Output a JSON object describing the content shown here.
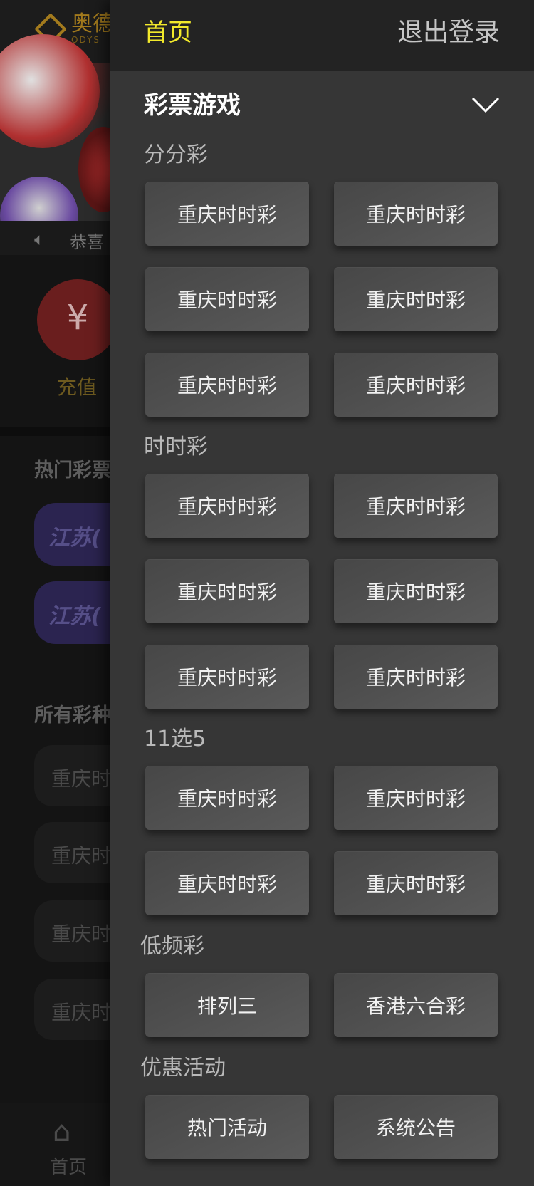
{
  "background": {
    "logo_text": "奥德",
    "logo_sub": "ODYS",
    "notice_text": "恭喜",
    "recharge_label": "充值",
    "hot_title": "热门彩票",
    "hot_items": [
      "江苏(",
      "江苏("
    ],
    "all_title": "所有彩种",
    "all_items": [
      "重庆时",
      "重庆时",
      "重庆时",
      "重庆时"
    ],
    "tab_home": "首页"
  },
  "drawer": {
    "home_label": "首页",
    "logout_label": "退出登录",
    "category_title": "彩票游戏",
    "groups": [
      {
        "label": "分分彩",
        "items": [
          "重庆时时彩",
          "重庆时时彩",
          "重庆时时彩",
          "重庆时时彩",
          "重庆时时彩",
          "重庆时时彩"
        ]
      },
      {
        "label": "时时彩",
        "items": [
          "重庆时时彩",
          "重庆时时彩",
          "重庆时时彩",
          "重庆时时彩",
          "重庆时时彩",
          "重庆时时彩"
        ]
      },
      {
        "label": "11选5",
        "items": [
          "重庆时时彩",
          "重庆时时彩",
          "重庆时时彩",
          "重庆时时彩"
        ]
      },
      {
        "label": "低频彩",
        "items": [
          "排列三",
          "香港六合彩"
        ]
      },
      {
        "label": "优惠活动",
        "items": [
          "热门活动",
          "系统公告"
        ]
      }
    ]
  },
  "colors": {
    "accent": "#f2e92b",
    "drawer_bg": "#363636",
    "drawer_header_bg": "#232323"
  },
  "icons": {
    "chevron": "chevron-down-icon",
    "speaker": "speaker-icon",
    "home": "home-icon",
    "yuan": "yuan-icon"
  }
}
